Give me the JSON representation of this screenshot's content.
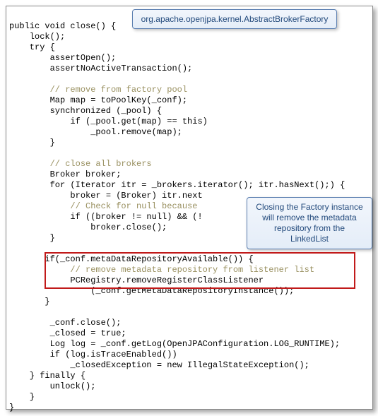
{
  "callout_top": "org.apache.openjpa.kernel.AbstractBrokerFactory",
  "callout_right": "Closing the Factory instance will remove the metadata repository from the LinkedList",
  "code": {
    "l1": "public void close() {",
    "l2": "    lock();",
    "l3": "    try {",
    "l4": "        assertOpen();",
    "l5": "        assertNoActiveTransaction();",
    "l6": "",
    "l7c": "        // remove from factory pool",
    "l8": "        Map map = toPoolKey(_conf);",
    "l9": "        synchronized (_pool) {",
    "l10": "            if (_pool.get(map) == this)",
    "l11": "                _pool.remove(map);",
    "l12": "        }",
    "l13": "",
    "l14c": "        // close all brokers",
    "l15": "        Broker broker;",
    "l16": "        for (Iterator itr = _brokers.iterator(); itr.hasNext();) {",
    "l17": "            broker = (Broker) itr.next",
    "l18p": "            ",
    "l18c": "// Check for null because",
    "l19": "            if ((broker != null) && (!",
    "l20": "                broker.close();",
    "l21": "        }",
    "l22": "",
    "l23": "       if(_conf.metaDataRepositoryAvailable()) {",
    "l24c": "            // remove metadata repository from listener list",
    "l25": "            PCRegistry.removeRegisterClassListener",
    "l26": "                (_conf.getMetaDataRepositoryInstance());",
    "l27": "       }",
    "l28": "",
    "l29": "        _conf.close();",
    "l30": "        _closed = true;",
    "l31": "        Log log = _conf.getLog(OpenJPAConfiguration.LOG_RUNTIME);",
    "l32": "        if (log.isTraceEnabled())",
    "l33": "            _closedException = new IllegalStateException();",
    "l34": "    } finally {",
    "l35": "        unlock();",
    "l36": "    }",
    "l37": "}"
  }
}
